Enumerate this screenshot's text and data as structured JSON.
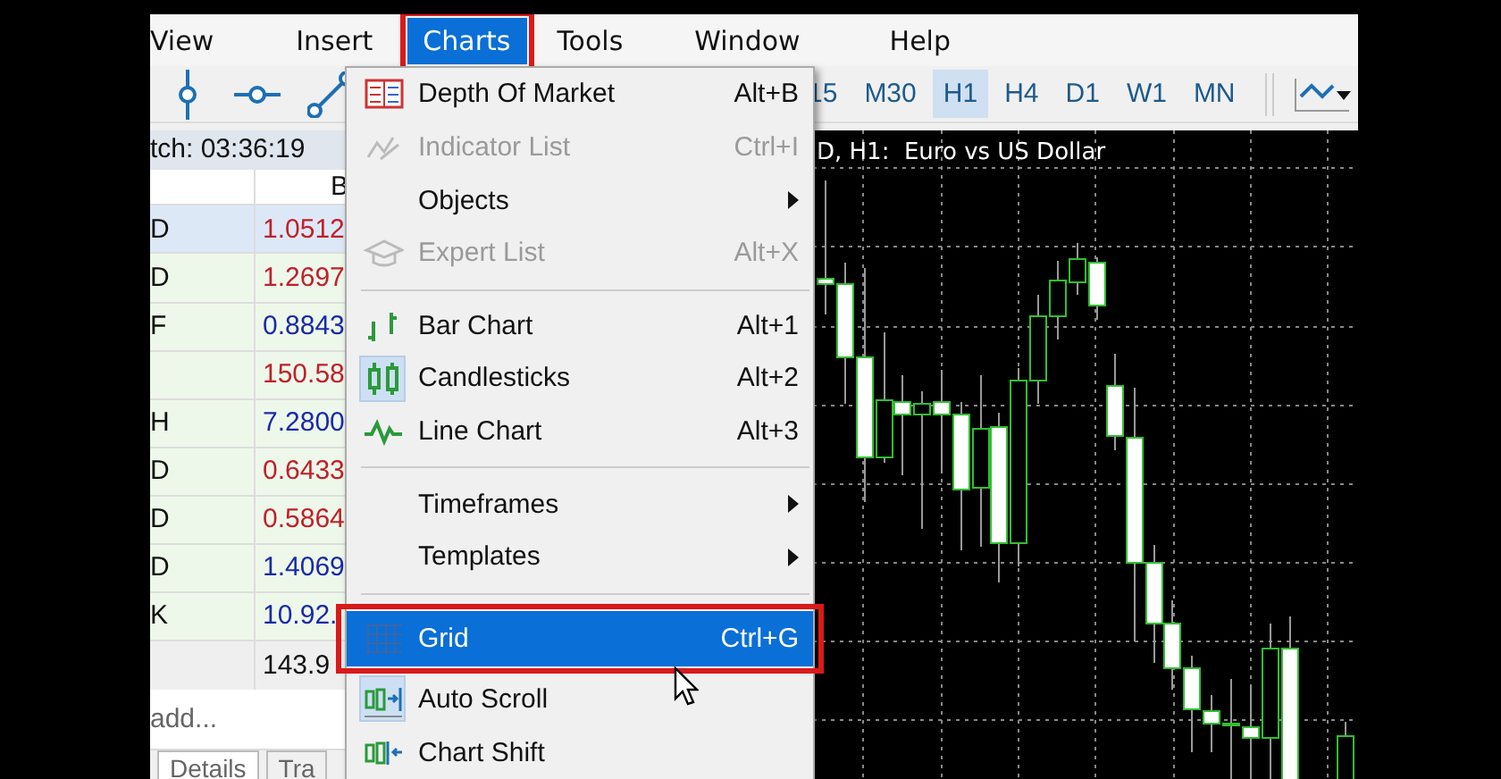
{
  "menu_bar": [
    {
      "label": "View",
      "selected": false,
      "highlighted": false
    },
    {
      "label": "Insert",
      "selected": false,
      "highlighted": false
    },
    {
      "label": "Charts",
      "selected": true,
      "highlighted": true
    },
    {
      "label": "Tools",
      "selected": false,
      "highlighted": false
    },
    {
      "label": "Window",
      "selected": false,
      "highlighted": false
    },
    {
      "label": "Help",
      "selected": false,
      "highlighted": false
    }
  ],
  "toolbar": {
    "timeframes": [
      {
        "label": "15",
        "selected": false
      },
      {
        "label": "M30",
        "selected": false
      },
      {
        "label": "H1",
        "selected": true
      },
      {
        "label": "H4",
        "selected": false
      },
      {
        "label": "D1",
        "selected": false
      },
      {
        "label": "W1",
        "selected": false
      },
      {
        "label": "MN",
        "selected": false
      }
    ]
  },
  "market_watch": {
    "title": "tch: 03:36:19",
    "columns": [
      "B"
    ],
    "rows": [
      {
        "symbol": "D",
        "bid": "1.0512",
        "color": "#c0202a",
        "selected": true
      },
      {
        "symbol": "D",
        "bid": "1.2697",
        "color": "#c0202a",
        "selected": false
      },
      {
        "symbol": "F",
        "bid": "0.8843",
        "color": "#1a2aa8",
        "selected": false
      },
      {
        "bid": "150.58",
        "color": "#c0202a",
        "selected": false
      },
      {
        "symbol": "H",
        "bid": "7.2800",
        "color": "#1a2aa8",
        "selected": false
      },
      {
        "symbol": "D",
        "bid": "0.6433",
        "color": "#c0202a",
        "selected": false
      },
      {
        "symbol": "D",
        "bid": "0.5864",
        "color": "#c0202a",
        "selected": false
      },
      {
        "symbol": "D",
        "bid": "1.4069",
        "color": "#1a2aa8",
        "selected": false
      },
      {
        "symbol": "K",
        "bid": "10.92.",
        "color": "#1a2aa8",
        "selected": false
      }
    ],
    "total": "143.9",
    "add_row": "add...",
    "tabs": [
      {
        "label": "Details",
        "selected": true
      },
      {
        "label": "Tra",
        "selected": false
      }
    ]
  },
  "chart": {
    "title": "D, H1:  Euro vs US Dollar"
  },
  "charts_menu": {
    "items": [
      {
        "kind": "item",
        "label": "Depth Of Market",
        "shortcut": "Alt+B",
        "disabled": false,
        "checked": false,
        "selected": false,
        "highlighted": false
      },
      {
        "kind": "item",
        "label": "Indicator List",
        "shortcut": "Ctrl+I",
        "disabled": true,
        "checked": false,
        "selected": false,
        "highlighted": false
      },
      {
        "kind": "submenu",
        "label": "Objects",
        "disabled": false,
        "checked": false,
        "selected": false,
        "highlighted": false
      },
      {
        "kind": "item",
        "label": "Expert List",
        "shortcut": "Alt+X",
        "disabled": true,
        "checked": false,
        "selected": false,
        "highlighted": false
      },
      {
        "kind": "separator"
      },
      {
        "kind": "item",
        "label": "Bar Chart",
        "shortcut": "Alt+1",
        "disabled": false,
        "checked": false,
        "selected": false,
        "highlighted": false
      },
      {
        "kind": "item",
        "label": "Candlesticks",
        "shortcut": "Alt+2",
        "disabled": false,
        "checked": true,
        "selected": false,
        "highlighted": false
      },
      {
        "kind": "item",
        "label": "Line Chart",
        "shortcut": "Alt+3",
        "disabled": false,
        "checked": false,
        "selected": false,
        "highlighted": false
      },
      {
        "kind": "separator"
      },
      {
        "kind": "submenu",
        "label": "Timeframes",
        "disabled": false,
        "checked": false,
        "selected": false,
        "highlighted": false
      },
      {
        "kind": "submenu",
        "label": "Templates",
        "disabled": false,
        "checked": false,
        "selected": false,
        "highlighted": false
      },
      {
        "kind": "separator"
      },
      {
        "kind": "item",
        "label": "Grid",
        "shortcut": "Ctrl+G",
        "disabled": false,
        "checked": false,
        "selected": true,
        "highlighted": true
      },
      {
        "kind": "item",
        "label": "Auto Scroll",
        "disabled": false,
        "checked": true,
        "selected": false,
        "highlighted": false
      },
      {
        "kind": "item",
        "label": "Chart Shift",
        "disabled": false,
        "checked": false,
        "selected": false,
        "highlighted": false
      }
    ]
  }
}
